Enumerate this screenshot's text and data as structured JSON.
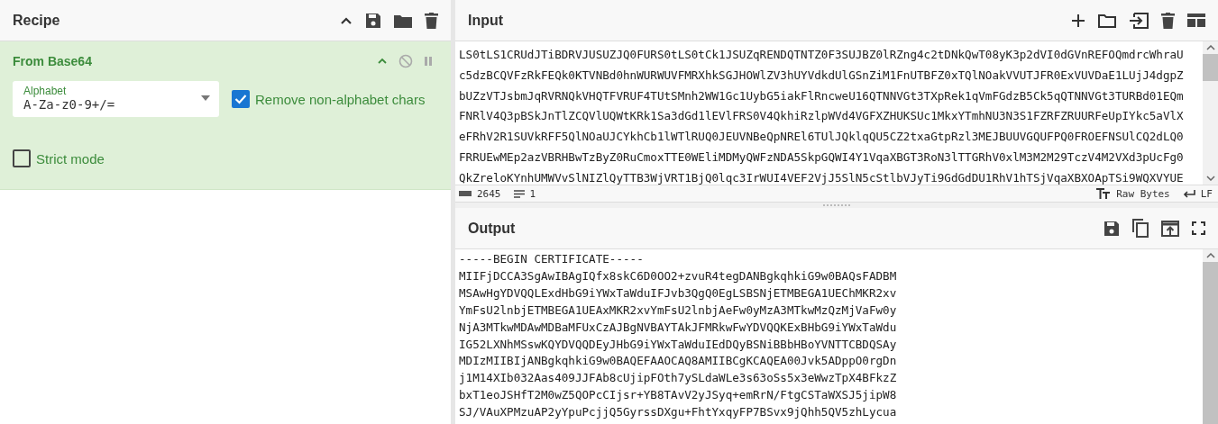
{
  "recipe": {
    "title": "Recipe",
    "operations": [
      {
        "title": "From Base64",
        "alphabet": {
          "label": "Alphabet",
          "value": "A-Za-z0-9+/="
        },
        "options": [
          {
            "label": "Remove non-alphabet chars",
            "checked": true
          },
          {
            "label": "Strict mode",
            "checked": false
          }
        ]
      }
    ]
  },
  "input": {
    "title": "Input",
    "lines": [
      "LS0tLS1CRUdJTiBDRVJUSUZJQ0FURS0tLS0tCk1JSUZqRENDQTNTZ0F3SUJBZ0lRZng4c2tDNkQwT08yK3p2dVI0dGVnREFOQmdrcWhraU",
      "c5dzBCQVFzRkFEQk0KTVNBd0hnWURWUVFMRXhkSGJHOWlZV3hUYVdkdUlGSnZiM1FnUTBFZ0xTQlNOakVVUTJFR0ExVUVDaE1LUjJ4dgpZ",
      "bUZzVTJsbmJqRVRNQkVHQTFVRUF4TUtSMnh2WW1Gc1UybG5iakFlRncweU16QTNNVGt3TXpRek1qVmFGdzB5Ck5qQTNNVGt3TURBd01EQm",
      "FNRlV4Q3pBSkJnTlZCQVlUQWtKRk1Sa3dGd1lEVlFRS0V4QkhiRzlpWVd4VGFXZHUKSUc1MkxYTmhNU3N3S1FZRFZRUURFeUpIYkc5aVlX",
      "eFRhV2R1SUVkRFF5QlNOaUJCYkhCb1lWTlRUQ0JEUVNBeQpNREl6TUlJQklqQU5CZ2txaGtpRzl3MEJBUUVGQUFPQ0FROEFNSUlCQ2dLQ0",
      "FRRUEwMEp2azVBRHBwTzByZ0RuCmoxTTE0WEliMDMyQWFzNDA5SkpGQWI4Y1VqaXBGT3RoN3lTTGRhV0xlM3M2M29TczV4M2VXd3pUcFg0",
      "QkZreloKYnhUMWVvSlNIZlQyTTB3WjVRT1BjQ0lqc3IrWUI4VEF2VjJ5SlN5cStlbVJyTi9GdGdDU1RhV1hTSjVqaXBXOApTSi9WQXVYUE"
    ],
    "status": {
      "length": "2645",
      "lines": "1",
      "format": "Raw Bytes",
      "eol": "LF"
    }
  },
  "output": {
    "title": "Output",
    "lines": [
      "-----BEGIN CERTIFICATE-----",
      "MIIFjDCCA3SgAwIBAgIQfx8skC6D0OO2+zvuR4tegDANBgkqhkiG9w0BAQsFADBM",
      "MSAwHgYDVQQLExdHbG9iYWxTaWduIFJvb3QgQ0EgLSBSNjETMBEGA1UEChMKR2xv",
      "YmFsU2lnbjETMBEGA1UEAxMKR2xvYmFsU2lnbjAeFw0yMzA3MTkwMzQzMjVaFw0y",
      "NjA3MTkwMDAwMDBaMFUxCzAJBgNVBAYTAkJFMRkwFwYDVQQKExBHbG9iYWxTaWdu",
      "IG52LXNhMSswKQYDVQQDEyJHbG9iYWxTaWduIEdDQyBSNiBBbHBoYVNTTCBDQSAy",
      "MDIzMIIBIjANBgkqhkiG9w0BAQEFAAOCAQ8AMIIBCgKCAQEA00Jvk5ADppO0rgDn",
      "j1M14XIb032Aas409JJFAb8cUjipFOth7ySLdaWLe3s63oSs5x3eWwzTpX4BFkzZ",
      "bxT1eoJSHfT2M0wZ5QOPcCIjsr+YB8TAvV2yJSyq+emRrN/FtgCSTaWXSJ5jipW8",
      "SJ/VAuXPMzuAP2yYpuPcjjQ5GyrssDXgu+FhtYxqyFP7BSvx9jQhh5QV5zhLycua"
    ]
  }
}
